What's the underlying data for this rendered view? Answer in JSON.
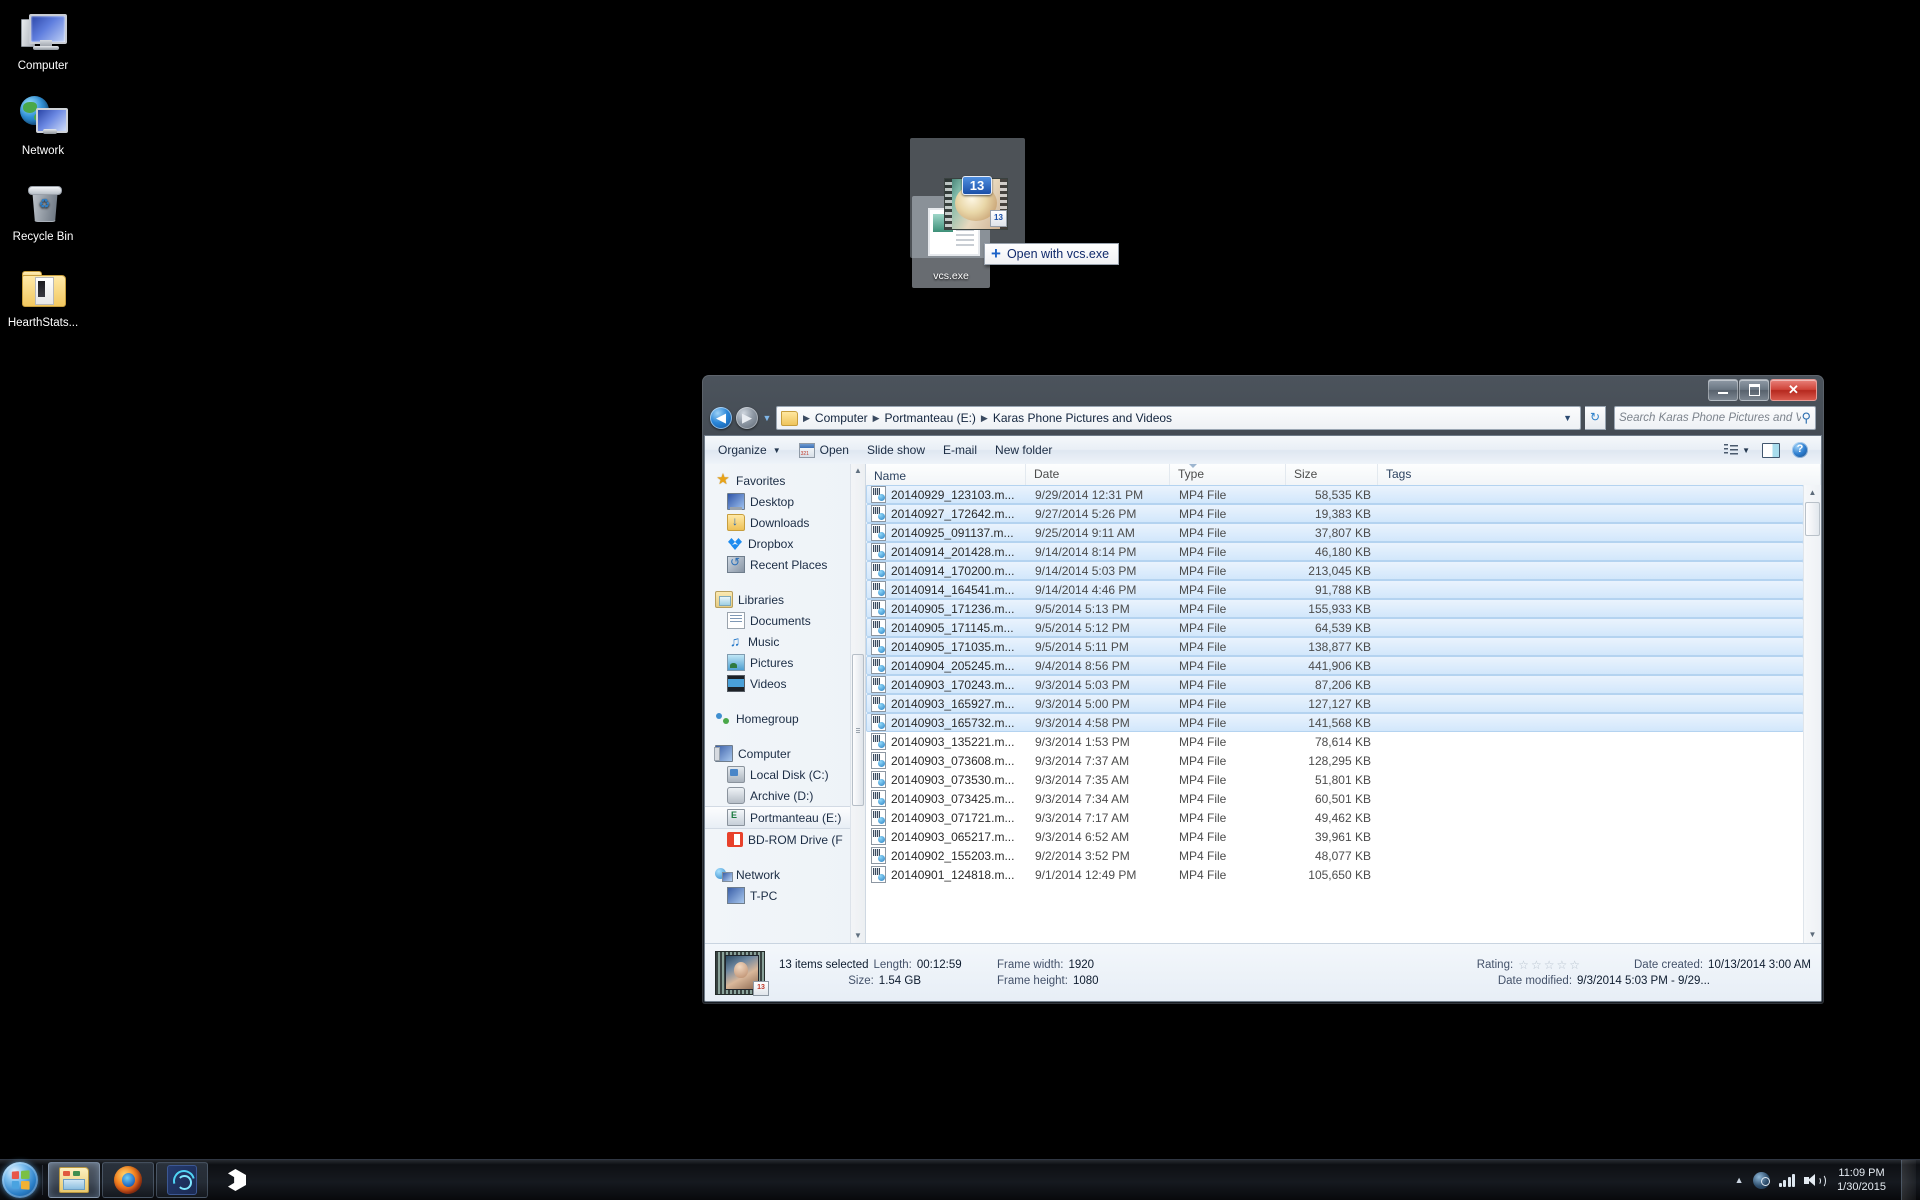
{
  "desktop": {
    "icons": [
      {
        "label": "Computer",
        "icon": "computer-icon"
      },
      {
        "label": "Network",
        "icon": "network-icon"
      },
      {
        "label": "Recycle Bin",
        "icon": "recycle-bin-icon"
      },
      {
        "label": "HearthStats...",
        "icon": "folder-icon"
      }
    ]
  },
  "drag": {
    "badge_count": "13",
    "source_label": "vcs.exe",
    "drop_hint": "Open with vcs.exe",
    "plus": "+",
    "small_badge": "13"
  },
  "window": {
    "buttons": {
      "minimize": "minimize",
      "maximize": "maximize",
      "close": "✕"
    },
    "address": {
      "back": "◀",
      "forward": "▶",
      "history_caret": "▼",
      "crumbs": [
        "Computer",
        "Portmanteau (E:)",
        "Karas Phone Pictures and Videos"
      ],
      "separator": "▶",
      "dropdown_caret": "▼",
      "refresh": "↻"
    },
    "search": {
      "placeholder": "Search Karas Phone Pictures and Vide...",
      "icon": "⚲"
    },
    "toolbar": {
      "organize": "Organize",
      "organize_caret": "▼",
      "open": "Open",
      "slide_show": "Slide show",
      "email": "E-mail",
      "new_folder": "New folder",
      "view_caret": "▼",
      "help": "?"
    },
    "navpane": {
      "groups": [
        {
          "header": {
            "label": "Favorites",
            "icon": "star-icon"
          },
          "items": [
            {
              "label": "Desktop",
              "icon": "desktop-icon"
            },
            {
              "label": "Downloads",
              "icon": "downloads-icon"
            },
            {
              "label": "Dropbox",
              "icon": "dropbox-icon"
            },
            {
              "label": "Recent Places",
              "icon": "recent-places-icon"
            }
          ]
        },
        {
          "header": {
            "label": "Libraries",
            "icon": "libraries-icon"
          },
          "items": [
            {
              "label": "Documents",
              "icon": "documents-icon"
            },
            {
              "label": "Music",
              "icon": "music-icon"
            },
            {
              "label": "Pictures",
              "icon": "pictures-icon"
            },
            {
              "label": "Videos",
              "icon": "videos-icon"
            }
          ]
        },
        {
          "header": {
            "label": "Homegroup",
            "icon": "homegroup-icon"
          },
          "items": []
        },
        {
          "header": {
            "label": "Computer",
            "icon": "computer-icon"
          },
          "items": [
            {
              "label": "Local Disk (C:)",
              "icon": "local-disk-icon",
              "selected": false
            },
            {
              "label": "Archive (D:)",
              "icon": "drive-icon",
              "selected": false
            },
            {
              "label": "Portmanteau (E:)",
              "icon": "usb-drive-icon",
              "selected": true
            },
            {
              "label": "BD-ROM Drive (F",
              "icon": "bd-rom-icon",
              "selected": false
            }
          ]
        },
        {
          "header": {
            "label": "Network",
            "icon": "network-icon"
          },
          "items": [
            {
              "label": "T-PC",
              "icon": "pc-icon"
            }
          ]
        }
      ]
    },
    "list": {
      "columns": [
        "Name",
        "Date",
        "Type",
        "Size",
        "Tags"
      ],
      "rows": [
        {
          "name": "20140929_123103.m...",
          "date": "9/29/2014 12:31 PM",
          "type": "MP4 File",
          "size": "58,535 KB",
          "tags": "",
          "selected": true
        },
        {
          "name": "20140927_172642.m...",
          "date": "9/27/2014 5:26 PM",
          "type": "MP4 File",
          "size": "19,383 KB",
          "tags": "",
          "selected": true
        },
        {
          "name": "20140925_091137.m...",
          "date": "9/25/2014 9:11 AM",
          "type": "MP4 File",
          "size": "37,807 KB",
          "tags": "",
          "selected": true
        },
        {
          "name": "20140914_201428.m...",
          "date": "9/14/2014 8:14 PM",
          "type": "MP4 File",
          "size": "46,180 KB",
          "tags": "",
          "selected": true
        },
        {
          "name": "20140914_170200.m...",
          "date": "9/14/2014 5:03 PM",
          "type": "MP4 File",
          "size": "213,045 KB",
          "tags": "",
          "selected": true
        },
        {
          "name": "20140914_164541.m...",
          "date": "9/14/2014 4:46 PM",
          "type": "MP4 File",
          "size": "91,788 KB",
          "tags": "",
          "selected": true
        },
        {
          "name": "20140905_171236.m...",
          "date": "9/5/2014 5:13 PM",
          "type": "MP4 File",
          "size": "155,933 KB",
          "tags": "",
          "selected": true
        },
        {
          "name": "20140905_171145.m...",
          "date": "9/5/2014 5:12 PM",
          "type": "MP4 File",
          "size": "64,539 KB",
          "tags": "",
          "selected": true
        },
        {
          "name": "20140905_171035.m...",
          "date": "9/5/2014 5:11 PM",
          "type": "MP4 File",
          "size": "138,877 KB",
          "tags": "",
          "selected": true
        },
        {
          "name": "20140904_205245.m...",
          "date": "9/4/2014 8:56 PM",
          "type": "MP4 File",
          "size": "441,906 KB",
          "tags": "",
          "selected": true
        },
        {
          "name": "20140903_170243.m...",
          "date": "9/3/2014 5:03 PM",
          "type": "MP4 File",
          "size": "87,206 KB",
          "tags": "",
          "selected": true
        },
        {
          "name": "20140903_165927.m...",
          "date": "9/3/2014 5:00 PM",
          "type": "MP4 File",
          "size": "127,127 KB",
          "tags": "",
          "selected": true
        },
        {
          "name": "20140903_165732.m...",
          "date": "9/3/2014 4:58 PM",
          "type": "MP4 File",
          "size": "141,568 KB",
          "tags": "",
          "selected": true
        },
        {
          "name": "20140903_135221.m...",
          "date": "9/3/2014 1:53 PM",
          "type": "MP4 File",
          "size": "78,614 KB",
          "tags": "",
          "selected": false
        },
        {
          "name": "20140903_073608.m...",
          "date": "9/3/2014 7:37 AM",
          "type": "MP4 File",
          "size": "128,295 KB",
          "tags": "",
          "selected": false
        },
        {
          "name": "20140903_073530.m...",
          "date": "9/3/2014 7:35 AM",
          "type": "MP4 File",
          "size": "51,801 KB",
          "tags": "",
          "selected": false
        },
        {
          "name": "20140903_073425.m...",
          "date": "9/3/2014 7:34 AM",
          "type": "MP4 File",
          "size": "60,501 KB",
          "tags": "",
          "selected": false
        },
        {
          "name": "20140903_071721.m...",
          "date": "9/3/2014 7:17 AM",
          "type": "MP4 File",
          "size": "49,462 KB",
          "tags": "",
          "selected": false
        },
        {
          "name": "20140903_065217.m...",
          "date": "9/3/2014 6:52 AM",
          "type": "MP4 File",
          "size": "39,961 KB",
          "tags": "",
          "selected": false
        },
        {
          "name": "20140902_155203.m...",
          "date": "9/2/2014 3:52 PM",
          "type": "MP4 File",
          "size": "48,077 KB",
          "tags": "",
          "selected": false
        },
        {
          "name": "20140901_124818.m...",
          "date": "9/1/2014 12:49 PM",
          "type": "MP4 File",
          "size": "105,650 KB",
          "tags": "",
          "selected": false
        }
      ]
    },
    "details": {
      "selection": "13 items selected",
      "length_key": "Length:",
      "length_val": "00:12:59",
      "size_key": "Size:",
      "size_val": "1.54 GB",
      "frame_width_key": "Frame width:",
      "frame_width_val": "1920",
      "frame_height_key": "Frame height:",
      "frame_height_val": "1080",
      "rating_key": "Rating:",
      "stars": [
        "☆",
        "☆",
        "☆",
        "☆",
        "☆"
      ],
      "date_created_key": "Date created:",
      "date_created_val": "10/13/2014 3:00 AM",
      "date_modified_key": "Date modified:",
      "date_modified_val": "9/3/2014 5:03 PM - 9/29...",
      "thumb_badge": "13"
    }
  },
  "taskbar": {
    "start": "start-orb",
    "apps": [
      {
        "name": "explorer",
        "state": "active"
      },
      {
        "name": "firefox",
        "state": "open"
      },
      {
        "name": "blue-app",
        "state": "open"
      },
      {
        "name": "unity",
        "state": "none"
      }
    ],
    "tray": {
      "caret": "▲",
      "steam": "steam-icon",
      "signal": "signal-icon",
      "volume": "volume-icon"
    },
    "clock": {
      "time": "11:09 PM",
      "date": "1/30/2015"
    }
  }
}
